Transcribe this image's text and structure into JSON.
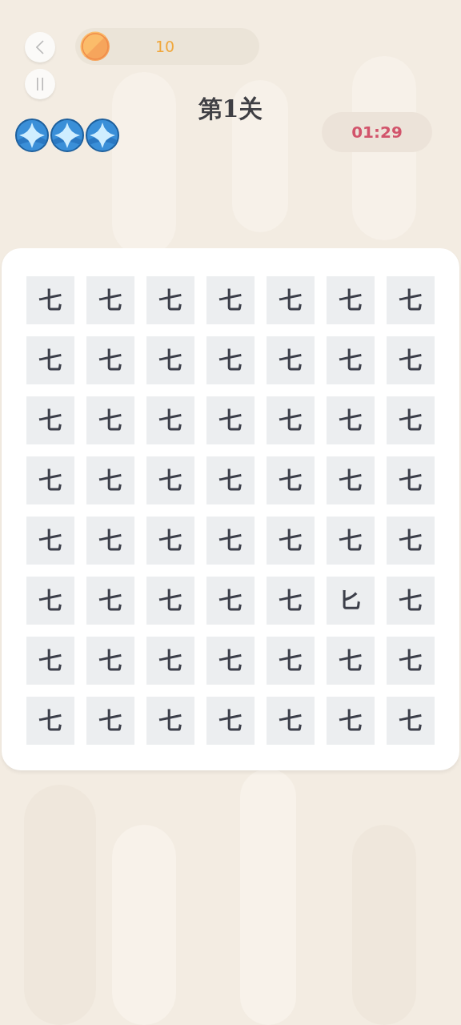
{
  "coins": {
    "amount": "10"
  },
  "title": "第1关",
  "lives": {
    "stars": 3
  },
  "timer": "01:29",
  "grid": [
    [
      "七",
      "七",
      "七",
      "七",
      "七",
      "七",
      "七"
    ],
    [
      "七",
      "七",
      "七",
      "七",
      "七",
      "七",
      "七"
    ],
    [
      "七",
      "七",
      "七",
      "七",
      "七",
      "七",
      "七"
    ],
    [
      "七",
      "七",
      "七",
      "七",
      "七",
      "七",
      "七"
    ],
    [
      "七",
      "七",
      "七",
      "七",
      "七",
      "七",
      "七"
    ],
    [
      "七",
      "七",
      "七",
      "七",
      "七",
      "匕",
      "七"
    ],
    [
      "七",
      "七",
      "七",
      "七",
      "七",
      "七",
      "七"
    ],
    [
      "七",
      "七",
      "七",
      "七",
      "七",
      "七",
      "七"
    ]
  ]
}
